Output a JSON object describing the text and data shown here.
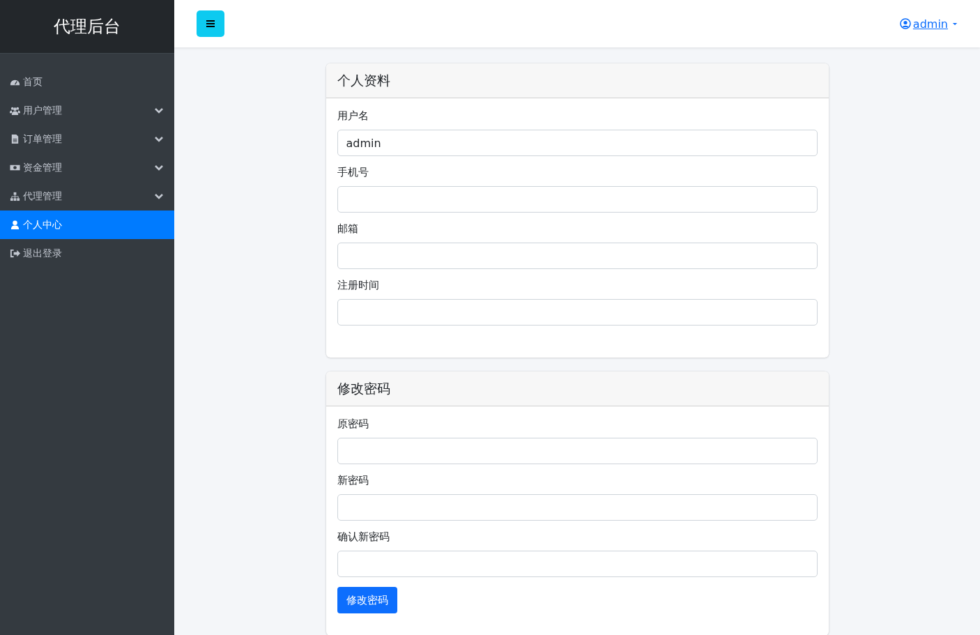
{
  "sidebar": {
    "brand": "代理后台",
    "items": [
      {
        "label": "首页",
        "expandable": false,
        "selected": false
      },
      {
        "label": "用户管理",
        "expandable": true,
        "selected": false
      },
      {
        "label": "订单管理",
        "expandable": true,
        "selected": false
      },
      {
        "label": "资金管理",
        "expandable": true,
        "selected": false
      },
      {
        "label": "代理管理",
        "expandable": true,
        "selected": false
      },
      {
        "label": "个人中心",
        "expandable": false,
        "selected": true
      },
      {
        "label": "退出登录",
        "expandable": false,
        "selected": false
      }
    ]
  },
  "header": {
    "user": "admin"
  },
  "cards": [
    {
      "title": "个人资料",
      "fields": [
        {
          "label": "用户名",
          "value": "admin"
        },
        {
          "label": "手机号"
        },
        {
          "label": "邮箱"
        },
        {
          "label": "注册时间"
        }
      ]
    },
    {
      "title": "修改密码",
      "fields": [
        {
          "label": "原密码"
        },
        {
          "label": "新密码"
        },
        {
          "label": "确认新密码"
        }
      ],
      "button": "修改密码"
    }
  ]
}
